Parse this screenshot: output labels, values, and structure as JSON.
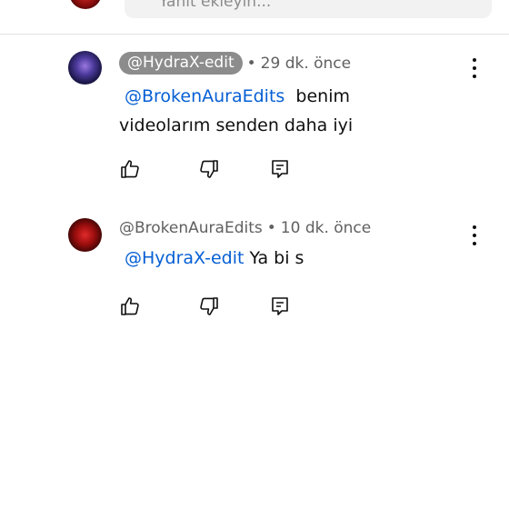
{
  "reply_bar": {
    "placeholder": "Yanıt ekleyin..."
  },
  "comments": [
    {
      "author": "@HydraX-edit",
      "author_highlighted": true,
      "time": "29 dk. önce",
      "mention": "@BrokenAuraEdits",
      "text": "benim videolarım senden daha iyi",
      "avatar_icon": "avatar-image"
    },
    {
      "author": "@BrokenAuraEdits",
      "author_highlighted": false,
      "time": "10 dk. önce",
      "mention": "@HydraX-edit",
      "text": "Ya bi s",
      "avatar_icon": "avatar-image"
    }
  ],
  "separator": "•",
  "icons": {
    "like": "thumbs-up-icon",
    "dislike": "thumbs-down-icon",
    "reply": "reply-icon",
    "more": "more-vertical-icon"
  },
  "colors": {
    "mention": "#065fd4",
    "chip": "#8c8c8c",
    "meta": "#606060"
  }
}
